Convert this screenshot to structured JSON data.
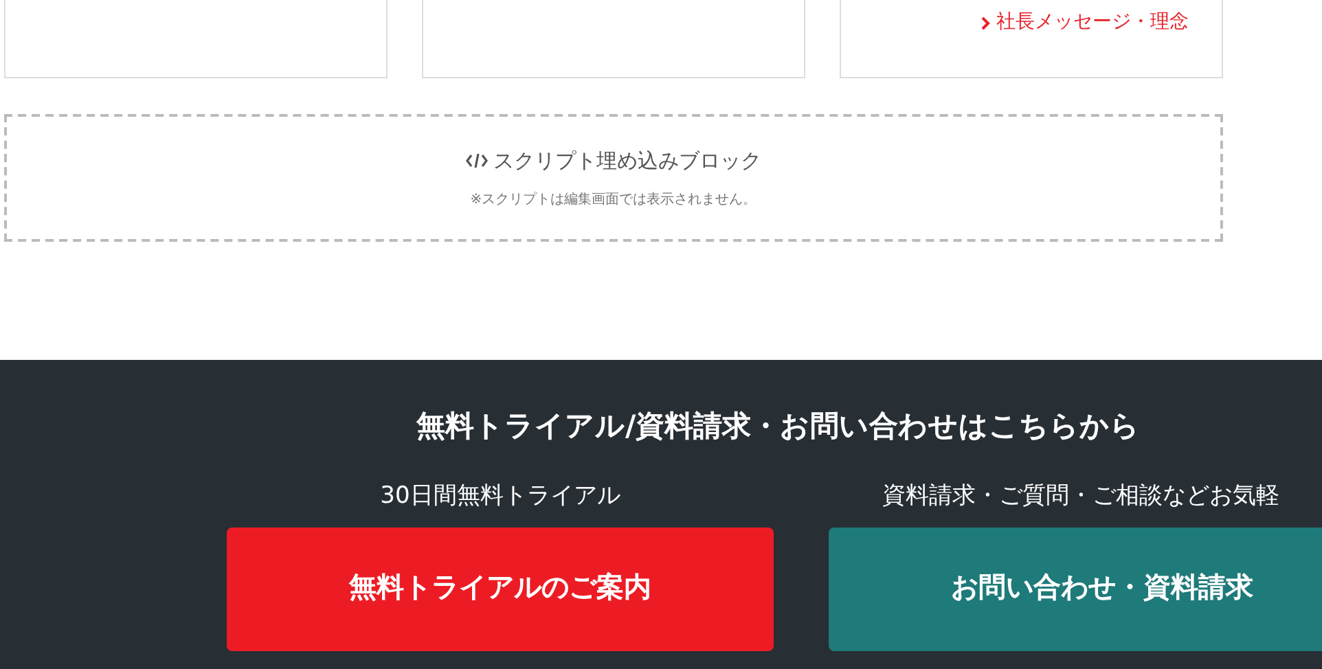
{
  "cards": [
    {
      "kind": "blank"
    },
    {
      "kind": "blank"
    },
    {
      "kind": "link",
      "link": "社長メッセージ・理念"
    }
  ],
  "script_block": {
    "title": "スクリプト埋め込みブロック",
    "note": "※スクリプトは編集画面では表示されません。"
  },
  "cta": {
    "title": "無料トライアル/資料請求・お問い合わせはこちらから",
    "columns": [
      {
        "kind": "trial",
        "label": "30日間無料トライアル",
        "button": "無料トライアルのご案内"
      },
      {
        "kind": "contact",
        "label": "資料請求・ご質問・ご相談などお気軽",
        "button": "お問い合わせ・資料請求"
      }
    ]
  }
}
